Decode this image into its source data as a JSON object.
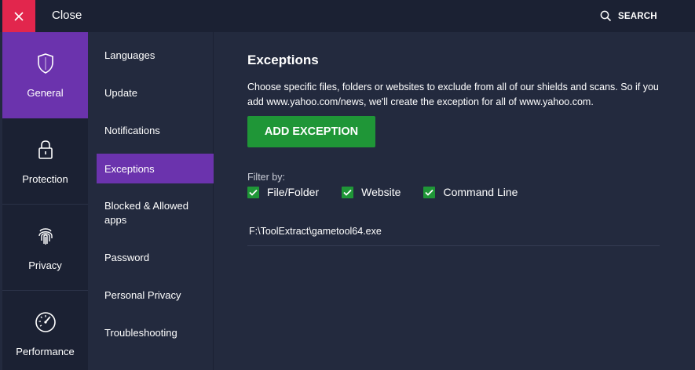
{
  "header": {
    "close_label": "Close",
    "search_label": "SEARCH"
  },
  "categories": [
    {
      "label": "General",
      "icon": "shield-icon",
      "active": true
    },
    {
      "label": "Protection",
      "icon": "lock-icon",
      "active": false
    },
    {
      "label": "Privacy",
      "icon": "fingerprint-icon",
      "active": false
    },
    {
      "label": "Performance",
      "icon": "speedometer-icon",
      "active": false
    }
  ],
  "submenu": [
    {
      "label": "Languages",
      "active": false
    },
    {
      "label": "Update",
      "active": false
    },
    {
      "label": "Notifications",
      "active": false
    },
    {
      "label": "Exceptions",
      "active": true
    },
    {
      "label": "Blocked & Allowed apps",
      "active": false
    },
    {
      "label": "Password",
      "active": false
    },
    {
      "label": "Personal Privacy",
      "active": false
    },
    {
      "label": "Troubleshooting",
      "active": false
    }
  ],
  "main": {
    "title": "Exceptions",
    "description": "Choose specific files, folders or websites to exclude from all of our shields and scans. So if you add www.yahoo.com/news, we'll create the exception for all of www.yahoo.com.",
    "add_button": "ADD EXCEPTION",
    "filter_label": "Filter by:",
    "filters": [
      {
        "label": "File/Folder",
        "checked": true
      },
      {
        "label": "Website",
        "checked": true
      },
      {
        "label": "Command Line",
        "checked": true
      }
    ],
    "exceptions": [
      "F:\\ToolExtract\\gametool64.exe"
    ]
  },
  "colors": {
    "accent": "#6b33ad",
    "close_red": "#e2264d",
    "green": "#1f9637",
    "background": "#232a3e",
    "rail_background": "#1b2133"
  }
}
